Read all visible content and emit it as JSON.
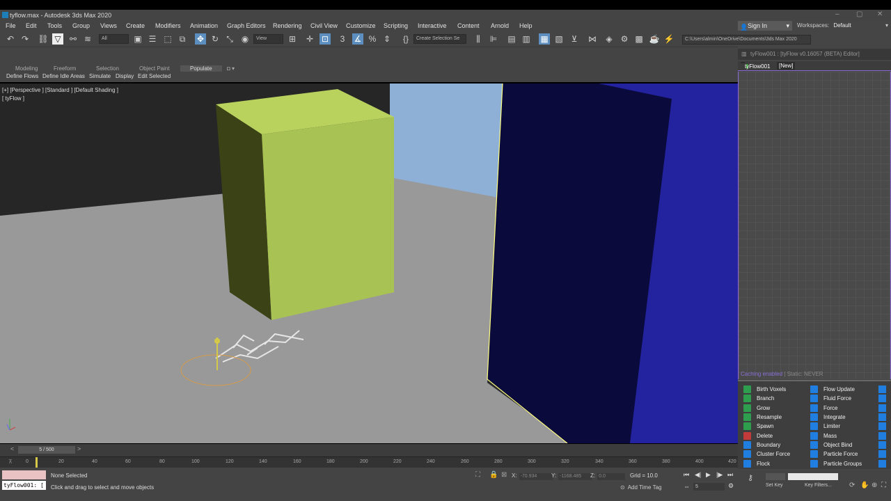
{
  "window": {
    "title": "tyflow.max - Autodesk 3ds Max 2020"
  },
  "menu": [
    "File",
    "Edit",
    "Tools",
    "Group",
    "Views",
    "Create",
    "Modifiers",
    "Animation",
    "Graph Editors",
    "Rendering",
    "Civil View",
    "Customize",
    "Scripting",
    "Interactive",
    "Content",
    "Arnold",
    "Help"
  ],
  "toolbar": {
    "filter_value": "All",
    "coord_value": "View",
    "selection_set_placeholder": "Create Selection Se"
  },
  "account": {
    "signin_label": "Sign In",
    "workspace_label": "Workspaces:",
    "workspace_value": "Default",
    "project_path": "C:\\Users\\almin\\OneDrive\\Documents\\3ds Max 2020"
  },
  "ribbon": {
    "tabs": [
      "Modeling",
      "Freeform",
      "Selection",
      "Object Paint",
      "Populate"
    ],
    "subtools": [
      "Define Flows",
      "Define Idle Areas",
      "Simulate",
      "Display",
      "Edit Selected"
    ]
  },
  "viewport": {
    "label": "[+] [Perspective ] [Standard ] [Default Shading ]",
    "sublabel": "[ tyFlow ]"
  },
  "tyflow": {
    "editor_title": "tyFlow001 : [tyFlow v0.16057 (BETA) Editor]",
    "tab_name": "tyFlow001",
    "tab_new": "[New]",
    "caching_text": "Caching enabled",
    "static_text": " | Static: NEVER",
    "operators_left": [
      {
        "label": "Birth Voxels",
        "color": "green"
      },
      {
        "label": "Branch",
        "color": "green"
      },
      {
        "label": "Grow",
        "color": "green"
      },
      {
        "label": "Resample",
        "color": "green"
      },
      {
        "label": "Spawn",
        "color": "green"
      },
      {
        "label": "Delete",
        "color": "red"
      },
      {
        "label": "Boundary",
        "color": "blue"
      },
      {
        "label": "Cluster Force",
        "color": "blue"
      },
      {
        "label": "Flock",
        "color": "blue"
      }
    ],
    "operators_right": [
      "Flow Update",
      "Fluid Force",
      "Force",
      "Integrate",
      "Limiter",
      "Mass",
      "Object Bind",
      "Particle Force",
      "Particle Groups"
    ]
  },
  "timeslider": {
    "frame_indicator": "5 / 500",
    "ticks": [
      "0",
      "20",
      "40",
      "60",
      "80",
      "100",
      "120",
      "140",
      "160",
      "180",
      "200",
      "220",
      "240",
      "260",
      "280",
      "300",
      "320",
      "340",
      "360",
      "380",
      "400",
      "420"
    ]
  },
  "status": {
    "maxscript_text": "tyFlow001: [",
    "selection_info": "None Selected",
    "prompt": "Click and drag to select and move objects",
    "x_label": "X:",
    "x_value": "-70.934",
    "y_label": "Y:",
    "y_value": "-1168.485",
    "z_label": "Z:",
    "z_value": "0.0",
    "grid": "Grid = 10.0",
    "add_time_tag": "Add Time Tag",
    "current_frame": "5",
    "set_key": "Set Key",
    "key_filters": "Key Filters..."
  },
  "colors": {
    "yellow_box": "#a9c254",
    "blue_panel": "#0a0a3c",
    "purple_wall": "#2323a0",
    "light_blue_wall": "#8eb0d6",
    "accent": "#8a68d6"
  }
}
